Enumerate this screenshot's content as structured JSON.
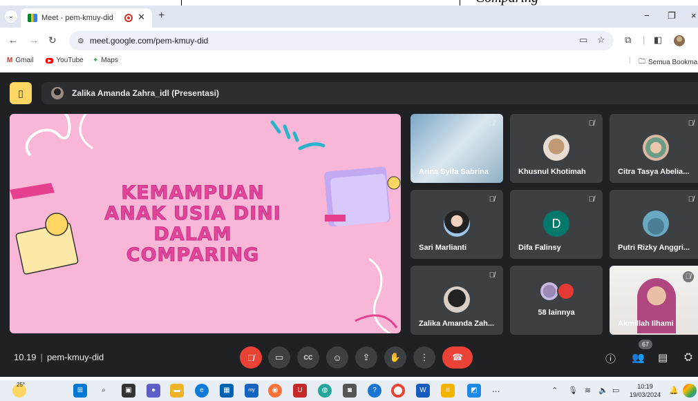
{
  "top_strip": {
    "cut_text": "Comparing"
  },
  "tab": {
    "title": "Meet - pem-kmuy-did",
    "new_tab": "+"
  },
  "window": {
    "minimize": "−",
    "restore": "❐",
    "close": "×"
  },
  "address": {
    "url": "meet.google.com/pem-kmuy-did"
  },
  "bookmarks": {
    "items": [
      {
        "label": "Gmail"
      },
      {
        "label": "YouTube"
      },
      {
        "label": "Maps"
      }
    ],
    "all_label": "Semua Bookma"
  },
  "meet": {
    "presenter_label": "Zalika Amanda Zahra_idl (Presentasi)",
    "slide_lines": [
      "KEMAMPUAN",
      "ANAK USIA DINI",
      "DALAM",
      "COMPARING"
    ],
    "participants": [
      {
        "name": "Arina Syifa Sabrina"
      },
      {
        "name": "Khusnul Khotimah"
      },
      {
        "name": "Citra Tasya Abelia..."
      },
      {
        "name": "Sari Marlianti"
      },
      {
        "name": "Difa Falinsy",
        "letter": "D"
      },
      {
        "name": "Putri Rizky Anggri..."
      },
      {
        "name": "Zalika Amanda Zah..."
      },
      {
        "name": "58 lainnya"
      },
      {
        "name": "Akmillah Ilhami"
      }
    ],
    "time": "10.19",
    "meeting_code": "pem-kmuy-did",
    "people_count": "67"
  },
  "taskbar": {
    "weather": "25°",
    "time": "10:19",
    "date": "19/03/2024",
    "overflow": "..."
  }
}
